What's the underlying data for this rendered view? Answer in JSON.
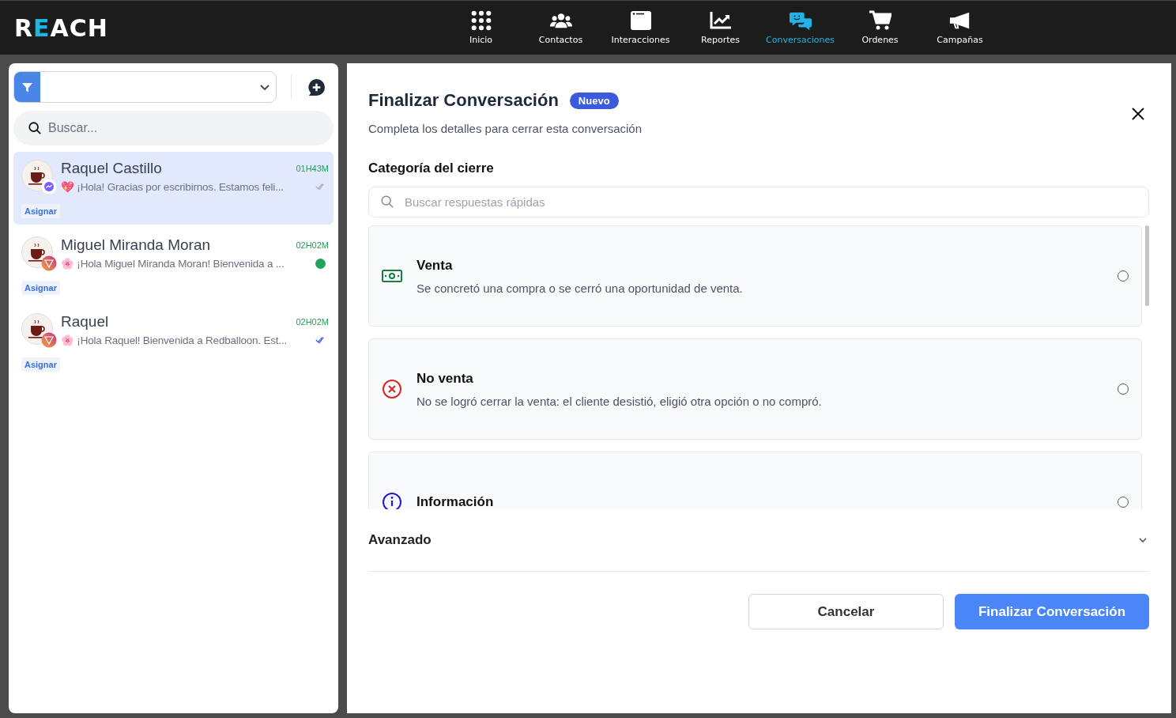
{
  "brand": {
    "logo_start": "R",
    "logo_accent": "E",
    "logo_end": "ACH"
  },
  "nav": [
    {
      "label": "Inicio",
      "selected": false
    },
    {
      "label": "Contactos",
      "selected": false
    },
    {
      "label": "Interacciones",
      "selected": false
    },
    {
      "label": "Reportes",
      "selected": false
    },
    {
      "label": "Conversaciones",
      "selected": true
    },
    {
      "label": "Ordenes",
      "selected": false
    },
    {
      "label": "Campañas",
      "selected": false
    }
  ],
  "sidebar": {
    "search": {
      "placeholder": "Buscar..."
    },
    "conversations": [
      {
        "name": "Raquel Castillo",
        "time": "01H43M",
        "emoji": "💖",
        "preview": "¡Hola! Gracias por escribirnos. Estamos feli...",
        "kind": "messenger",
        "indicator": {
          "kind": "delivered"
        },
        "tag": "Asignar",
        "selected": true
      },
      {
        "name": "Miguel Miranda Moran",
        "time": "02H02M",
        "emoji": "🌸",
        "preview": "¡Hola Miguel Miranda Moran! Bienvenida a ...",
        "kind": "instagram",
        "indicator": {
          "kind": "online"
        },
        "tag": "Asignar",
        "selected": false
      },
      {
        "name": "Raquel",
        "time": "02H02M",
        "emoji": "🌸",
        "preview": "¡Hola Raquel! Bienvenida a Redballoon. Est...",
        "kind": "instagram",
        "indicator": {
          "kind": "read"
        },
        "tag": "Asignar",
        "selected": false
      }
    ]
  },
  "dialog": {
    "title": "Finalizar Conversación",
    "badge": "Nuevo",
    "subtitle": "Completa los detalles para cerrar esta conversación",
    "section": "Categoría del cierre",
    "search": {
      "placeholder": "Buscar respuestas rápidas"
    },
    "options": [
      {
        "kind": "sale",
        "title": "Venta",
        "description": "Se concretó una compra o se cerró una oportunidad de venta.",
        "selected": false
      },
      {
        "kind": "nosale",
        "title": "No venta",
        "description": "No se logró cerrar la venta: el cliente desistió, eligió otra opción o no compró.",
        "selected": false
      },
      {
        "kind": "info",
        "title": "Información",
        "selected": false
      }
    ],
    "advanced": {
      "label": "Avanzado",
      "expanded": false
    },
    "buttons": [
      {
        "kind": "secondary",
        "label": "Cancelar"
      },
      {
        "kind": "primary",
        "label": "Finalizar Conversación"
      }
    ]
  }
}
